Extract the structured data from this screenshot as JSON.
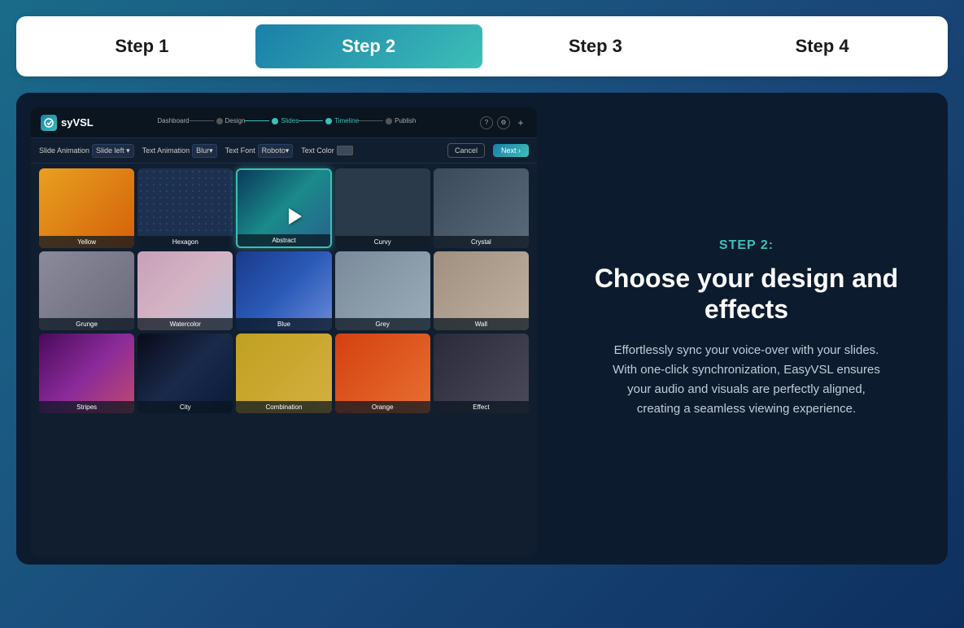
{
  "steps": {
    "items": [
      {
        "label": "Step 1",
        "active": false
      },
      {
        "label": "Step 2",
        "active": true
      },
      {
        "label": "Step 3",
        "active": false
      },
      {
        "label": "Step 4",
        "active": false
      }
    ]
  },
  "app": {
    "logo_text": "syVSL",
    "nav_steps": [
      "Dashboard",
      "Design",
      "Slides",
      "Timeline",
      "Publish"
    ],
    "toolbar": {
      "slide_animation_label": "Slide Animation",
      "slide_left_label": "Slide left ▾",
      "text_animation_label": "Text Animation",
      "blur_label": "Blur▾",
      "text_font_label": "Text Font",
      "roboto_label": "Roboto▾",
      "text_color_label": "Text Color",
      "cancel_label": "Cancel",
      "next_label": "Next ›"
    },
    "thumbnails": [
      {
        "label": "Yellow",
        "bg": "bg-yellow",
        "selected": false
      },
      {
        "label": "Hexagon",
        "bg": "bg-hexagon",
        "selected": false
      },
      {
        "label": "Abstract",
        "bg": "bg-abstract",
        "selected": true
      },
      {
        "label": "Curvy",
        "bg": "bg-curvy",
        "selected": false
      },
      {
        "label": "Crystal",
        "bg": "bg-crystal",
        "selected": false
      },
      {
        "label": "Grunge",
        "bg": "bg-grunge",
        "selected": false
      },
      {
        "label": "Watercolor",
        "bg": "bg-watercolor",
        "selected": false
      },
      {
        "label": "Blue",
        "bg": "bg-blue",
        "selected": false
      },
      {
        "label": "Grey",
        "bg": "bg-grey",
        "selected": false
      },
      {
        "label": "Wall",
        "bg": "bg-wall",
        "selected": false
      },
      {
        "label": "Stripes",
        "bg": "bg-stripes",
        "selected": false
      },
      {
        "label": "City",
        "bg": "bg-city",
        "selected": false
      },
      {
        "label": "Combination",
        "bg": "bg-combination",
        "selected": false
      },
      {
        "label": "Orange",
        "bg": "bg-orange",
        "selected": false
      },
      {
        "label": "Effect",
        "bg": "bg-effect",
        "selected": false
      }
    ]
  },
  "info": {
    "step_label": "STEP 2:",
    "title": "Choose your design\nand effects",
    "description": "Effortlessly sync your voice-over with your slides. With one-click synchronization, EasyVSL ensures your audio and visuals are perfectly aligned, creating a seamless viewing experience."
  }
}
